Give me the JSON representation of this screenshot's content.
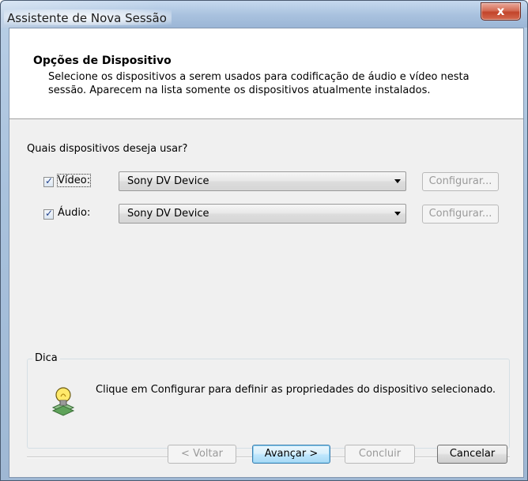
{
  "window": {
    "title": "Assistente de Nova Sessão",
    "close_glyph": "x"
  },
  "header": {
    "title": "Opções de Dispositivo",
    "description": "Selecione os dispositivos a serem usados para codificação de áudio e vídeo nesta sessão. Aparecem na lista somente os dispositivos atualmente instalados."
  },
  "body": {
    "question": "Quais dispositivos deseja usar?",
    "devices": [
      {
        "label": "Vídeo:",
        "checked": true,
        "selected_device": "Sony DV Device",
        "configure_label": "Configurar..."
      },
      {
        "label": "Áudio:",
        "checked": true,
        "selected_device": "Sony DV Device",
        "configure_label": "Configurar..."
      }
    ],
    "tip": {
      "legend": "Dica",
      "text": "Clique em Configurar para definir as propriedades do dispositivo selecionado.",
      "icon": "lightbulb-tip-icon"
    }
  },
  "footer": {
    "back_label": "< Voltar",
    "next_label": "Avançar >",
    "finish_label": "Concluir",
    "cancel_label": "Cancelar"
  },
  "colors": {
    "title_bar": "#a8c1de",
    "close_button": "#c2442a",
    "panel_background": "#f0f0f0",
    "default_button": "#bee6fd"
  }
}
